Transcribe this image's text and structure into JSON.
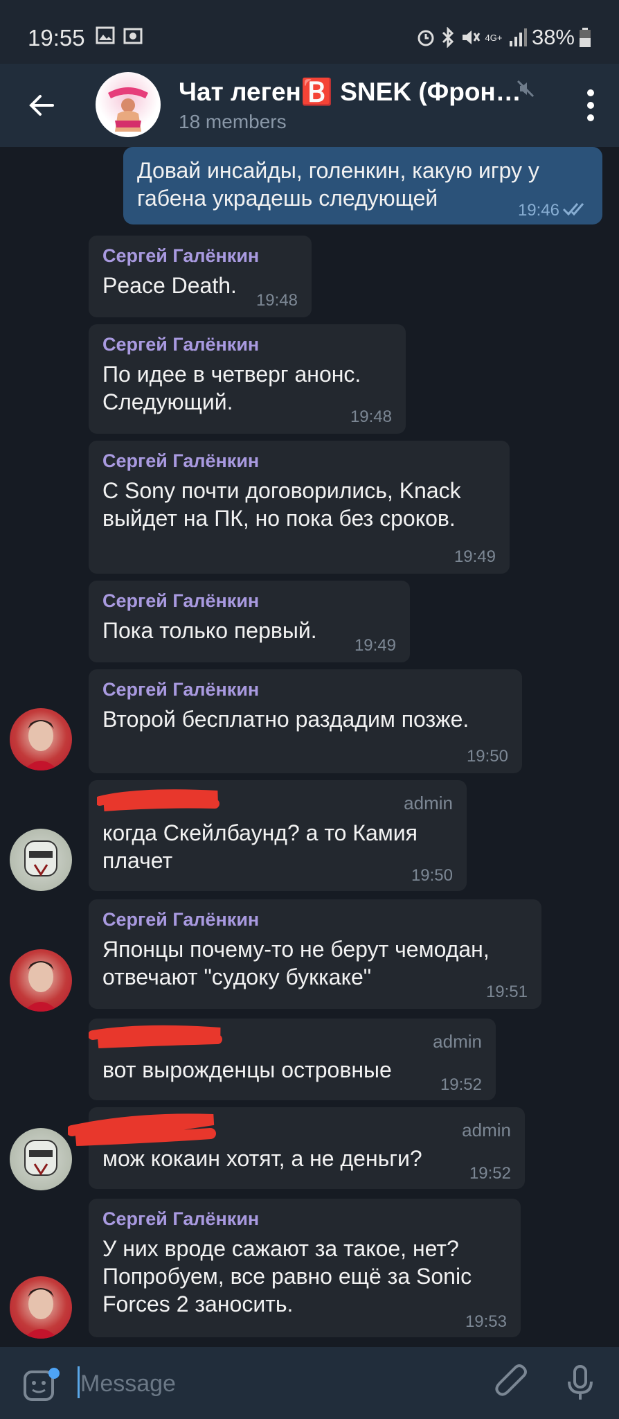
{
  "status": {
    "time": "19:55",
    "battery": "38%",
    "network": "4G+"
  },
  "header": {
    "title": "Чат леген🅱️ SNEK (Фрон…",
    "subtitle": "18 members"
  },
  "messages": [
    {
      "text": "Довай инсайды, голенкин, какую игру у\nгабена украдешь следующей",
      "time": "19:46"
    },
    {
      "sender": "Сергей Галёнкин",
      "text": "Peace Death.",
      "time": "19:48"
    },
    {
      "sender": "Сергей Галёнкин",
      "text": "По идее в четверг анонс.\nСледующий.",
      "time": "19:48"
    },
    {
      "sender": "Сергей Галёнкин",
      "text": "С Sony почти договорились, Knack\nвыйдет на ПК, но пока без сроков.",
      "time": "19:49"
    },
    {
      "sender": "Сергей Галёнкин",
      "text": "Пока только первый.",
      "time": "19:49"
    },
    {
      "sender": "Сергей Галёнкин",
      "text": "Второй бесплатно раздадим позже.",
      "time": "19:50"
    },
    {
      "role": "admin",
      "text": "когда Скейлбаунд? а то Камия\nплачет",
      "time": "19:50"
    },
    {
      "sender": "Сергей Галёнкин",
      "text": "Японцы почему-то не берут чемодан,\nотвечают \"судоку буккаке\"",
      "time": "19:51"
    },
    {
      "role": "admin",
      "text": "вот вырожденцы островные",
      "time": "19:52"
    },
    {
      "role": "admin",
      "text": "мож кокаин хотят, а не деньги?",
      "time": "19:52"
    },
    {
      "sender": "Сергей Галёнкин",
      "text": "У них вроде сажают за такое, нет?\nПопробуем, все равно ещё за Sonic\nForces 2 заносить.",
      "time": "19:53"
    }
  ],
  "input": {
    "placeholder": "Message"
  },
  "colors": {
    "outgoing_bubble": "#2b5279",
    "incoming_bubble": "#23282f",
    "sender_name": "#a99ae0",
    "redaction": "#e8372c"
  }
}
